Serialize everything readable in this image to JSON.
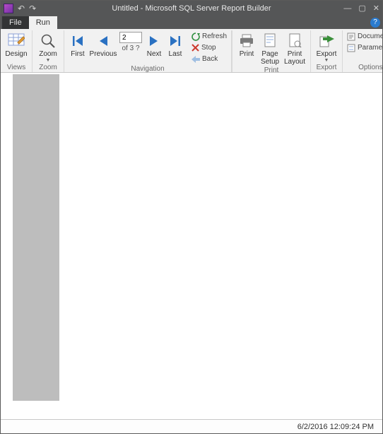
{
  "window": {
    "title": "Untitled - Microsoft SQL Server Report Builder"
  },
  "tabs": {
    "file": "File",
    "run": "Run"
  },
  "ribbon": {
    "views": {
      "group": "Views",
      "design": "Design"
    },
    "zoom": {
      "group": "Zoom",
      "zoom": "Zoom"
    },
    "nav": {
      "group": "Navigation",
      "first": "First",
      "previous": "Previous",
      "page_value": "2",
      "of_text": "of 3 ?",
      "next": "Next",
      "last": "Last",
      "refresh": "Refresh",
      "stop": "Stop",
      "back": "Back"
    },
    "print": {
      "group": "Print",
      "print": "Print",
      "page_setup": "Page\nSetup",
      "print_layout": "Print\nLayout"
    },
    "export": {
      "group": "Export",
      "export": "Export"
    },
    "options": {
      "group": "Options",
      "document": "Document",
      "parameters": "Parameters"
    }
  },
  "status": {
    "timestamp": "6/2/2016 12:09:24 PM"
  }
}
